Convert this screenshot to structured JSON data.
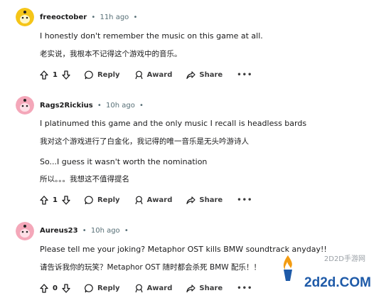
{
  "colors": {
    "text": "#1a1a1b",
    "meta": "#576f76",
    "avatar_c1": "#f5c518",
    "avatar_c2": "#f4a7b9",
    "avatar_c3": "#f4a7b9"
  },
  "comments": [
    {
      "user": "freeoctober",
      "time": "11h ago",
      "sep": "•",
      "lines": [
        "I honestly don't remember the music on this game at all.",
        "老实说，我根本不记得这个游戏中的音乐。"
      ],
      "votes": "1"
    },
    {
      "user": "Rags2Rickius",
      "time": "10h ago",
      "sep": "•",
      "lines": [
        "I platinumed this game and the only music I recall is headless bards",
        "我对这个游戏进行了白金化，我记得的唯一音乐是无头吟游诗人",
        "So...I guess it wasn't worth the nomination",
        "所以。。。我想这不值得提名"
      ],
      "votes": "1"
    },
    {
      "user": "Aureus23",
      "time": "10h ago",
      "sep": "•",
      "lines": [
        "Please tell me your joking? Metaphor OST kills BMW soundtrack anyday!!",
        "请告诉我你的玩笑？Metaphor OST 随时都会杀死 BMW 配乐！！"
      ],
      "votes": "0"
    }
  ],
  "actions": {
    "reply": "Reply",
    "award": "Award",
    "share": "Share",
    "more": "•••"
  },
  "watermark": {
    "small": "2D2D手游网",
    "big": "2d2d.COM"
  }
}
